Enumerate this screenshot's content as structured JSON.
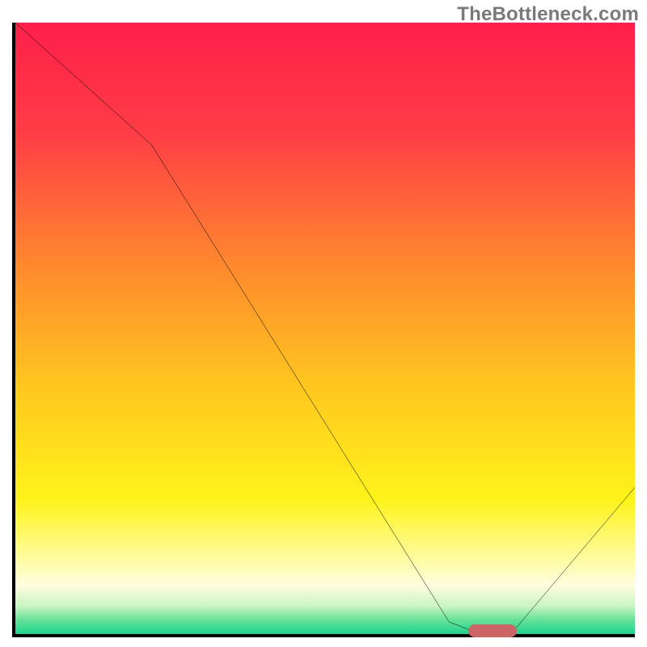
{
  "watermark": "TheBottleneck.com",
  "chart_data": {
    "type": "line",
    "title": "",
    "xlabel": "",
    "ylabel": "",
    "xlim": [
      0,
      100
    ],
    "ylim": [
      0,
      100
    ],
    "series": [
      {
        "name": "curve",
        "x": [
          0,
          22,
          70,
          75,
          80,
          100
        ],
        "values": [
          100,
          80,
          2,
          0,
          0,
          24
        ]
      }
    ],
    "gradient_stops": [
      {
        "pos": 0.0,
        "color": "#ff1f4a"
      },
      {
        "pos": 0.18,
        "color": "#ff3d46"
      },
      {
        "pos": 0.4,
        "color": "#ff8a2d"
      },
      {
        "pos": 0.6,
        "color": "#ffc81f"
      },
      {
        "pos": 0.78,
        "color": "#fff31a"
      },
      {
        "pos": 0.88,
        "color": "#fffca6"
      },
      {
        "pos": 0.92,
        "color": "#fffde0"
      },
      {
        "pos": 0.955,
        "color": "#c8f5c1"
      },
      {
        "pos": 0.975,
        "color": "#6be49a"
      },
      {
        "pos": 1.0,
        "color": "#1fd38c"
      }
    ],
    "marker": {
      "x": 77,
      "y": 0.5,
      "color": "#cc6666"
    }
  }
}
